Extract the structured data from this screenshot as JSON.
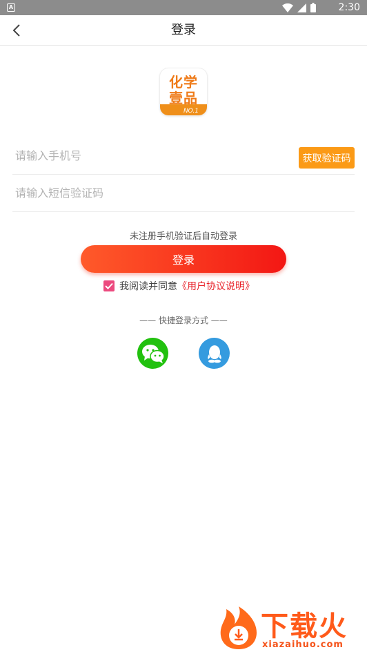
{
  "status_bar": {
    "time": "2:30",
    "icons": [
      "wifi-icon",
      "signal-icon",
      "battery-icon"
    ]
  },
  "header": {
    "title": "登录",
    "back_icon": "chevron-left-icon"
  },
  "logo": {
    "line1": "化学",
    "line2": "壹品",
    "badge": "NO.1"
  },
  "form": {
    "phone": {
      "placeholder": "请输入手机号",
      "value": ""
    },
    "get_code_label": "获取验证码",
    "sms_code": {
      "placeholder": "请输入短信验证码",
      "value": ""
    }
  },
  "hint": "未注册手机验证后自动登录",
  "login_button": "登录",
  "agreement": {
    "checked": true,
    "text": "我阅读并同意",
    "link": "《用户协议说明》"
  },
  "quick_login": {
    "label": "—— 快捷登录方式 ——",
    "options": [
      "wechat-icon",
      "qq-icon"
    ]
  },
  "watermark": {
    "cn": "下载火",
    "en": "xiazaihuo.com"
  },
  "colors": {
    "accent_orange": "#fb9a16",
    "login_gradient_start": "#ff5a2a",
    "login_gradient_end": "#f31714",
    "checkbox": "#ec4a7f",
    "link_red": "#e8222a",
    "wechat_green": "#22c10f",
    "qq_blue": "#359bdf"
  }
}
